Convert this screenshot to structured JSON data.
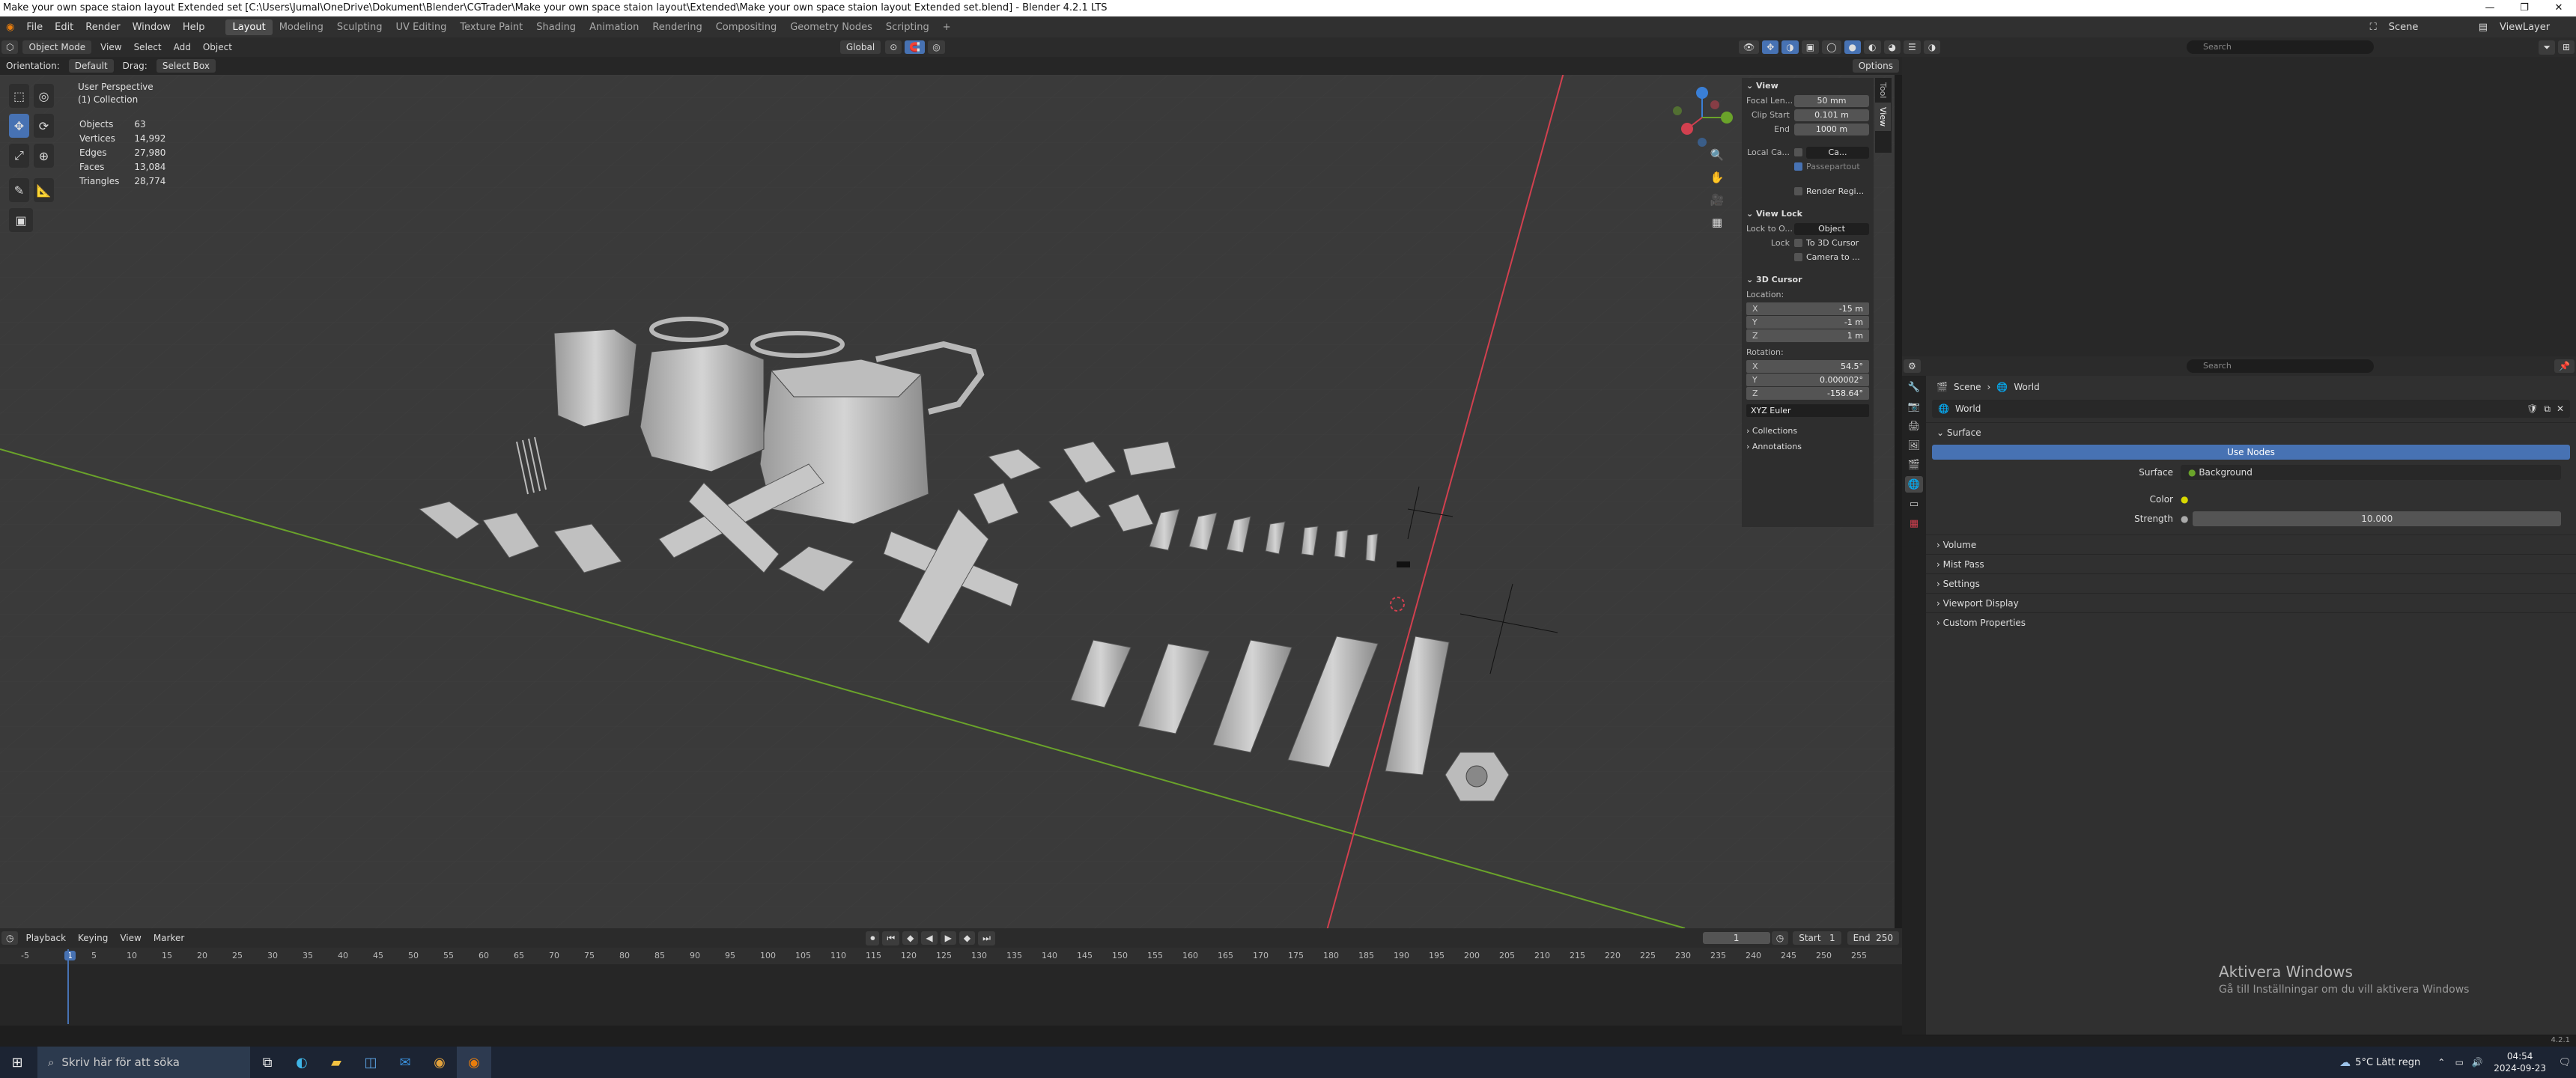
{
  "title_bar": {
    "title": "Make your own space staion layout Extended set [C:\\Users\\Jumal\\OneDrive\\Dokument\\Blender\\CGTrader\\Make your own space staion layout\\Extended\\Make your own space staion layout Extended set.blend] - Blender 4.2.1 LTS",
    "minimize": "—",
    "maximize": "❐",
    "close": "✕"
  },
  "menu": {
    "items": [
      "File",
      "Edit",
      "Render",
      "Window",
      "Help"
    ],
    "workspaces": [
      "Layout",
      "Modeling",
      "Sculpting",
      "UV Editing",
      "Texture Paint",
      "Shading",
      "Animation",
      "Rendering",
      "Compositing",
      "Geometry Nodes",
      "Scripting"
    ],
    "add_workspace": "+",
    "scene": "Scene",
    "view_layer": "ViewLayer"
  },
  "viewport_header": {
    "mode": "Object Mode",
    "menus": [
      "View",
      "Select",
      "Add",
      "Object"
    ],
    "transform": "Global",
    "orientation_label": "Orientation:",
    "orientation_value": "Default",
    "drag_label": "Drag:",
    "drag_value": "Select Box",
    "options": "Options"
  },
  "viewport_info": {
    "perspective": "User Perspective",
    "collection": "(1) Collection"
  },
  "stats": [
    {
      "label": "Objects",
      "value": "63"
    },
    {
      "label": "Vertices",
      "value": "14,992"
    },
    {
      "label": "Edges",
      "value": "27,980"
    },
    {
      "label": "Faces",
      "value": "13,084"
    },
    {
      "label": "Triangles",
      "value": "28,774"
    }
  ],
  "gizmo": {
    "x": "X",
    "y": "Y",
    "z": "Z"
  },
  "npanel": {
    "tabs": [
      "Tool",
      "View"
    ],
    "view_section": "View",
    "focal_label": "Focal Len...",
    "focal_value": "50 mm",
    "clip_start_label": "Clip Start",
    "clip_start_value": "0.101 m",
    "clip_end_label": "End",
    "clip_end_value": "1000 m",
    "local_camera_label": "Local Ca...",
    "local_camera_value": "Ca...",
    "passepartout": "Passepartout",
    "render_region": "Render Regi...",
    "view_lock_section": "View Lock",
    "lock_to_object_label": "Lock to O...",
    "lock_to_object_value": "Object",
    "lock_label": "Lock",
    "to_3d_cursor": "To 3D Cursor",
    "camera_to": "Camera to ...",
    "cursor_section": "3D Cursor",
    "location_label": "Location:",
    "location": [
      {
        "k": "X",
        "v": "-15 m"
      },
      {
        "k": "Y",
        "v": "-1 m"
      },
      {
        "k": "Z",
        "v": "1 m"
      }
    ],
    "rotation_label": "Rotation:",
    "rotation": [
      {
        "k": "X",
        "v": "54.5°"
      },
      {
        "k": "Y",
        "v": "0.000002°"
      },
      {
        "k": "Z",
        "v": "-158.64°"
      }
    ],
    "rotation_mode": "XYZ Euler",
    "collections": "Collections",
    "annotations": "Annotations"
  },
  "timeline": {
    "menus": [
      "Playback",
      "Keying",
      "View",
      "Marker"
    ],
    "current_frame": "1",
    "start_label": "Start",
    "start": "1",
    "end_label": "End",
    "end": "250",
    "ruler": [
      "-5",
      "1",
      "5",
      "10",
      "15",
      "20",
      "25",
      "30",
      "35",
      "40",
      "45",
      "50",
      "55",
      "60",
      "65",
      "70",
      "75",
      "80",
      "85",
      "90",
      "95",
      "100",
      "105",
      "110",
      "115",
      "120",
      "125",
      "130",
      "135",
      "140",
      "145",
      "150",
      "155",
      "160",
      "165",
      "170",
      "175",
      "180",
      "185",
      "190",
      "195",
      "200",
      "205",
      "210",
      "215",
      "220",
      "225",
      "230",
      "235",
      "240",
      "245",
      "250",
      "255"
    ]
  },
  "outliner": {
    "search_placeholder": "Search"
  },
  "properties": {
    "search_placeholder": "Search",
    "breadcrumb_scene": "Scene",
    "breadcrumb_world": "World",
    "world_name": "World",
    "surface_section": "Surface",
    "use_nodes": "Use Nodes",
    "surface_label": "Surface",
    "surface_value": "Background",
    "color_label": "Color",
    "strength_label": "Strength",
    "strength_value": "10.000",
    "sections": [
      "Volume",
      "Mist Pass",
      "Settings",
      "Viewport Display",
      "Custom Properties"
    ]
  },
  "watermark": {
    "line1": "Aktivera Windows",
    "line2": "Gå till Inställningar om du vill aktivera Windows"
  },
  "status": {
    "version": "4.2.1"
  },
  "taskbar": {
    "search_placeholder": "Skriv här för att söka",
    "weather": "5°C  Lätt regn",
    "time": "04:54",
    "date": "2024-09-23"
  },
  "colors": {
    "accent": "#4772b3",
    "x_axis": "#d2404f",
    "y_axis": "#6aa32a",
    "z_axis": "#3a7fd6",
    "grid": "#444444"
  }
}
